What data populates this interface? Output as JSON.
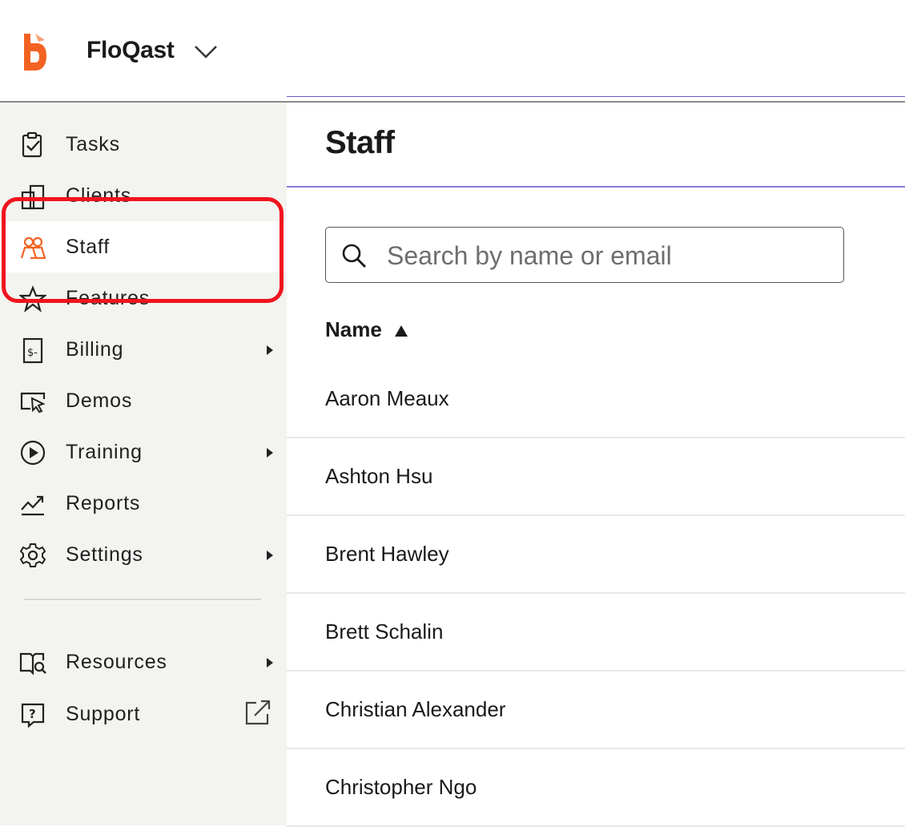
{
  "header": {
    "org_name": "FloQast"
  },
  "page": {
    "title": "Staff"
  },
  "search": {
    "placeholder": "Search by name or email",
    "value": ""
  },
  "table": {
    "column_header": "Name",
    "sort_direction": "ascending",
    "rows": [
      "Aaron Meaux",
      "Ashton Hsu",
      "Brent Hawley",
      "Brett Schalin",
      "Christian Alexander",
      "Christopher Ngo"
    ]
  },
  "sidebar": {
    "items": [
      {
        "label": "Tasks",
        "icon": "clipboard-check-icon",
        "active": false,
        "has_submenu": false
      },
      {
        "label": "Clients",
        "icon": "building-icon",
        "active": false,
        "has_submenu": false
      },
      {
        "label": "Staff",
        "icon": "people-icon",
        "active": true,
        "has_submenu": false
      },
      {
        "label": "Features",
        "icon": "star-icon",
        "active": false,
        "has_submenu": false
      },
      {
        "label": "Billing",
        "icon": "invoice-icon",
        "active": false,
        "has_submenu": true
      },
      {
        "label": "Demos",
        "icon": "cursor-window-icon",
        "active": false,
        "has_submenu": false
      },
      {
        "label": "Training",
        "icon": "play-circle-icon",
        "active": false,
        "has_submenu": true
      },
      {
        "label": "Reports",
        "icon": "trend-chart-icon",
        "active": false,
        "has_submenu": false
      },
      {
        "label": "Settings",
        "icon": "gear-icon",
        "active": false,
        "has_submenu": true
      }
    ],
    "footer_items": [
      {
        "label": "Resources",
        "icon": "book-search-icon",
        "has_submenu": true
      },
      {
        "label": "Support",
        "icon": "help-bubble-icon",
        "external": true
      }
    ]
  },
  "colors": {
    "brand": "#f26322",
    "sidebar_bg": "#f3f3f0",
    "highlight": "#f0141e",
    "accent_line": "#6a5acd"
  }
}
